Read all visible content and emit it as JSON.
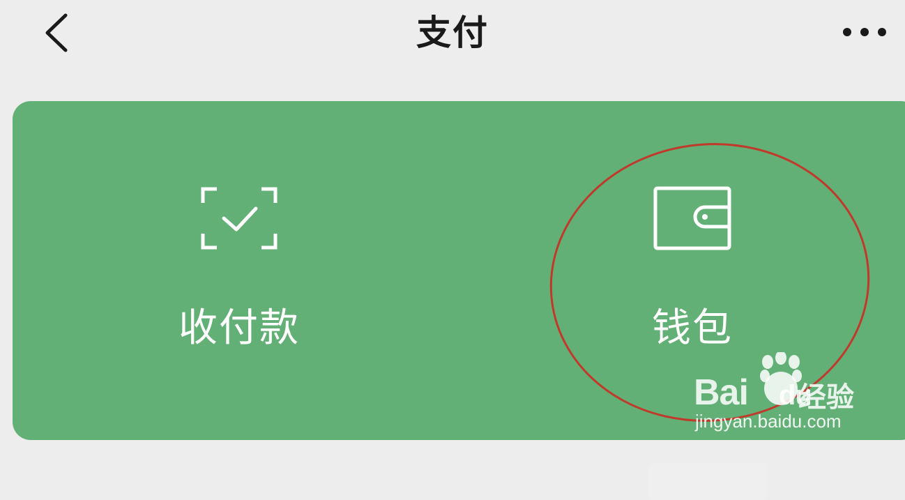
{
  "header": {
    "title": "支付",
    "back_icon": "chevron-left-icon",
    "more_icon": "more-dots-icon"
  },
  "card": {
    "background": "#63b077",
    "items": [
      {
        "label": "收付款",
        "icon": "scan-check-icon"
      },
      {
        "label": "钱包",
        "icon": "wallet-icon"
      }
    ]
  },
  "annotation": {
    "color": "#c0392b",
    "target": "钱包"
  },
  "watermark": {
    "brand": "Bai",
    "brand_suffix": "du",
    "product": "经验",
    "url": "jingyan.baidu.com"
  }
}
